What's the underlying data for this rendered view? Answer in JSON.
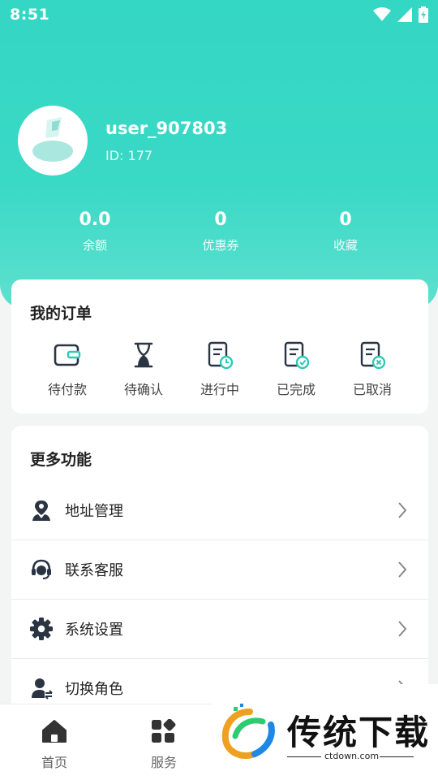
{
  "status_bar": {
    "time": "8:51"
  },
  "profile": {
    "username": "user_907803",
    "id_label": "ID: 177"
  },
  "stats": [
    {
      "value": "0.0",
      "label": "余额"
    },
    {
      "value": "0",
      "label": "优惠券"
    },
    {
      "value": "0",
      "label": "收藏"
    }
  ],
  "orders": {
    "title": "我的订单",
    "items": [
      {
        "label": "待付款",
        "icon": "wallet-icon"
      },
      {
        "label": "待确认",
        "icon": "hourglass-icon"
      },
      {
        "label": "进行中",
        "icon": "doc-clock-icon"
      },
      {
        "label": "已完成",
        "icon": "doc-check-icon"
      },
      {
        "label": "已取消",
        "icon": "doc-cancel-icon"
      }
    ]
  },
  "more": {
    "title": "更多功能",
    "items": [
      {
        "label": "地址管理",
        "icon": "location-person-icon"
      },
      {
        "label": "联系客服",
        "icon": "headset-icon"
      },
      {
        "label": "系统设置",
        "icon": "gear-icon"
      },
      {
        "label": "切换角色",
        "icon": "switch-user-icon"
      }
    ]
  },
  "tabbar": {
    "items": [
      {
        "label": "首页",
        "icon": "home-icon"
      },
      {
        "label": "服务",
        "icon": "grid-icon"
      }
    ]
  },
  "watermark": {
    "text": "传统下载",
    "url": "ctdown.com"
  },
  "colors": {
    "accent": "#34d6c4",
    "icon_dark": "#2a3442",
    "teal_badge": "#2ec9b4"
  }
}
